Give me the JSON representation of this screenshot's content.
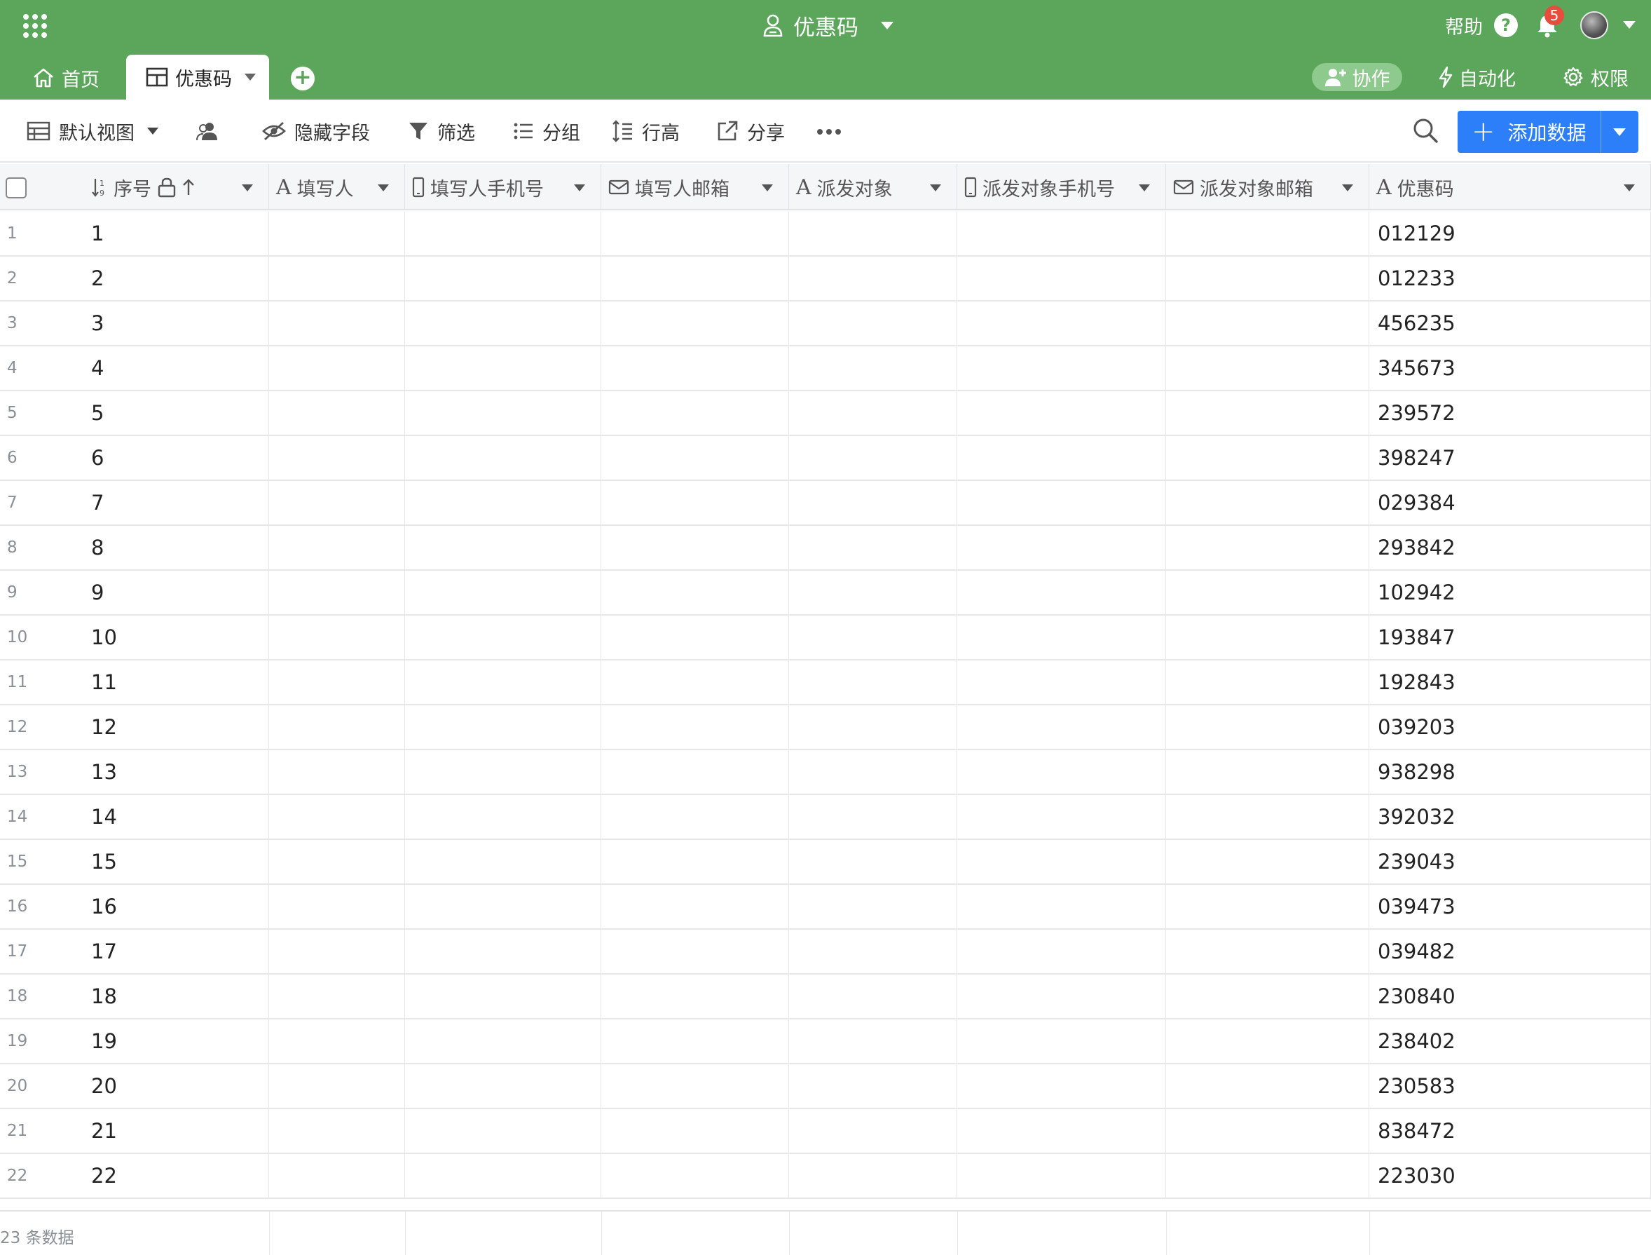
{
  "header": {
    "base_title": "优惠码",
    "help_label": "帮助",
    "notification_count": "5",
    "tabs": [
      {
        "label": "首页"
      },
      {
        "label": "优惠码"
      }
    ],
    "right_actions": {
      "collaborate": "协作",
      "automation": "自动化",
      "permissions": "权限"
    },
    "theme_color": "#5ba65b"
  },
  "toolbar": {
    "view_name": "默认视图",
    "hide_fields": "隐藏字段",
    "filter": "筛选",
    "group": "分组",
    "row_height": "行高",
    "share": "分享",
    "add_record": "添加数据",
    "add_color": "#2d7ff9"
  },
  "columns": [
    {
      "label": "序号",
      "icon": "sort-number-icon"
    },
    {
      "label": "填写人",
      "icon": "text-icon"
    },
    {
      "label": "填写人手机号",
      "icon": "phone-icon"
    },
    {
      "label": "填写人邮箱",
      "icon": "email-icon"
    },
    {
      "label": "派发对象",
      "icon": "text-icon"
    },
    {
      "label": "派发对象手机号",
      "icon": "phone-icon"
    },
    {
      "label": "派发对象邮箱",
      "icon": "email-icon"
    },
    {
      "label": "优惠码",
      "icon": "text-icon"
    }
  ],
  "rows": [
    {
      "num": "1",
      "seq": "1",
      "code": "012129"
    },
    {
      "num": "2",
      "seq": "2",
      "code": "012233"
    },
    {
      "num": "3",
      "seq": "3",
      "code": "456235"
    },
    {
      "num": "4",
      "seq": "4",
      "code": "345673"
    },
    {
      "num": "5",
      "seq": "5",
      "code": "239572"
    },
    {
      "num": "6",
      "seq": "6",
      "code": "398247"
    },
    {
      "num": "7",
      "seq": "7",
      "code": "029384"
    },
    {
      "num": "8",
      "seq": "8",
      "code": "293842"
    },
    {
      "num": "9",
      "seq": "9",
      "code": "102942"
    },
    {
      "num": "10",
      "seq": "10",
      "code": "193847"
    },
    {
      "num": "11",
      "seq": "11",
      "code": "192843"
    },
    {
      "num": "12",
      "seq": "12",
      "code": "039203"
    },
    {
      "num": "13",
      "seq": "13",
      "code": "938298"
    },
    {
      "num": "14",
      "seq": "14",
      "code": "392032"
    },
    {
      "num": "15",
      "seq": "15",
      "code": "239043"
    },
    {
      "num": "16",
      "seq": "16",
      "code": "039473"
    },
    {
      "num": "17",
      "seq": "17",
      "code": "039482"
    },
    {
      "num": "18",
      "seq": "18",
      "code": "230840"
    },
    {
      "num": "19",
      "seq": "19",
      "code": "238402"
    },
    {
      "num": "20",
      "seq": "20",
      "code": "230583"
    },
    {
      "num": "21",
      "seq": "21",
      "code": "838472"
    },
    {
      "num": "22",
      "seq": "22",
      "code": "223030"
    }
  ],
  "footer": {
    "record_count": "23 条数据"
  }
}
